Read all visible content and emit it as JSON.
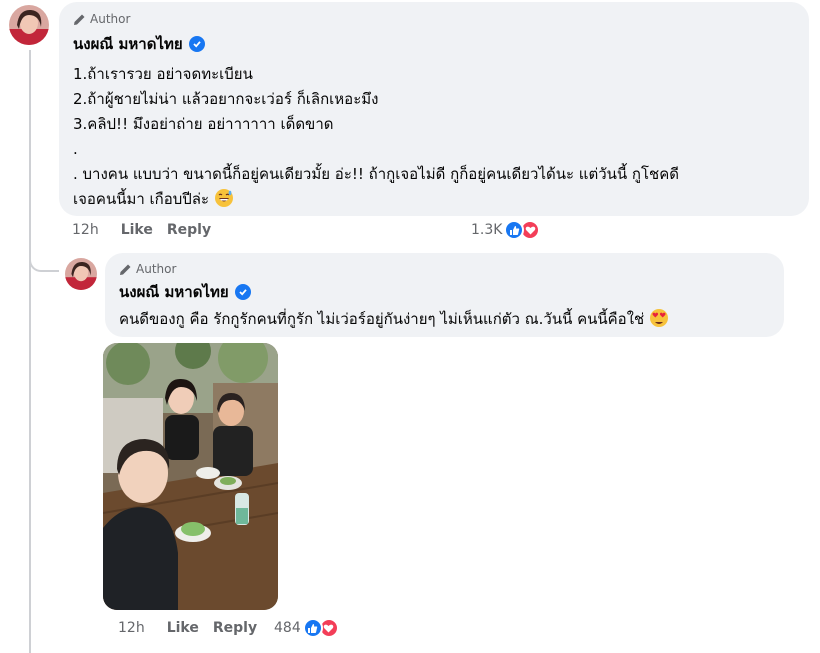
{
  "comment": {
    "badge": "Author",
    "name": "นงผณี มหาดไทย",
    "lines": [
      "1.ถ้าเรารวย อย่าจดทะเบียน",
      "2.ถ้าผู้ชายไม่น่า แล้วอยากจะเว่อร์ ก็เลิกเหอะมึง",
      "3.คลิป!! มึงอย่าถ่าย อย่าาาาาา เด็ดขาด",
      ".",
      ". บางคน แบบว่า ขนาดนี้ก็อยู่คนเดียวมั้ย อ่ะ!! ถ้ากูเจอไม่ดี กูก็อยู่คนเดียวได้นะ แต่วันนี้ กูโชคดี",
      "เจอคนนี้มา เกือบปีล่ะ"
    ],
    "emoji": "grinning-sweat-emoji",
    "time": "12h",
    "like_label": "Like",
    "reply_label": "Reply",
    "reaction_count": "1.3K"
  },
  "reply": {
    "badge": "Author",
    "name": "นงผณี มหาดไทย",
    "text": "คนดีของกู คือ รักกูรักคนที่กูรัก ไม่เว่อร์อยู่กันง่ายๆ ไม่เห็นแก่ตัว ณ.วันนี้ คนนี้คือใช่",
    "emoji": "heart-eyes-emoji",
    "time": "12h",
    "like_label": "Like",
    "reply_label": "Reply",
    "reaction_count": "484"
  },
  "colors": {
    "bubble": "#f0f2f5",
    "like": "#1877f2",
    "love": "#f33e58",
    "meta": "#65676b"
  }
}
